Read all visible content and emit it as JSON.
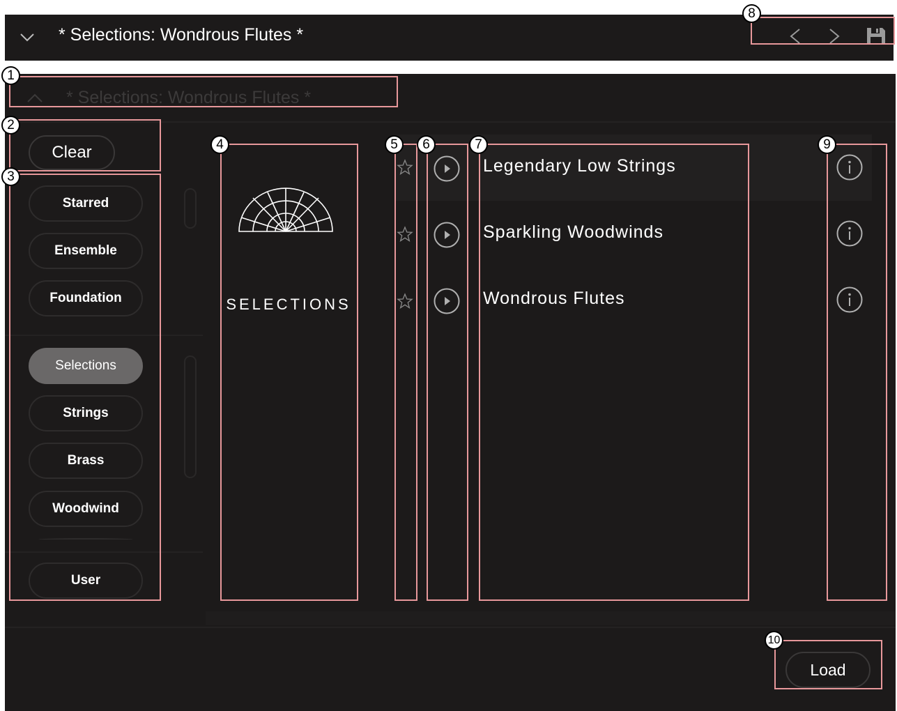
{
  "header": {
    "title": "* Selections: Wondrous Flutes *"
  },
  "panel": {
    "title": "* Selections: Wondrous Flutes *"
  },
  "sidebar": {
    "clear_label": "Clear",
    "filters": [
      {
        "label": "Starred"
      },
      {
        "label": "Ensemble"
      },
      {
        "label": "Foundation"
      }
    ],
    "categories": [
      {
        "label": "Selections",
        "selected": true
      },
      {
        "label": "Strings"
      },
      {
        "label": "Brass"
      },
      {
        "label": "Woodwind"
      }
    ],
    "user_label": "User"
  },
  "library": {
    "name": "SELECTIONS",
    "logo_icon": "fan-logo-icon"
  },
  "presets": [
    {
      "name": "Legendary Low Strings"
    },
    {
      "name": "Sparkling Woodwinds"
    },
    {
      "name": "Wondrous Flutes"
    }
  ],
  "footer": {
    "load_label": "Load"
  },
  "annotations": [
    "1",
    "2",
    "3",
    "4",
    "5",
    "6",
    "7",
    "8",
    "9",
    "10"
  ],
  "colors": {
    "background": "#1c1a1a",
    "selected_pill": "#6a6868",
    "annotation_box": "#e8989b"
  }
}
